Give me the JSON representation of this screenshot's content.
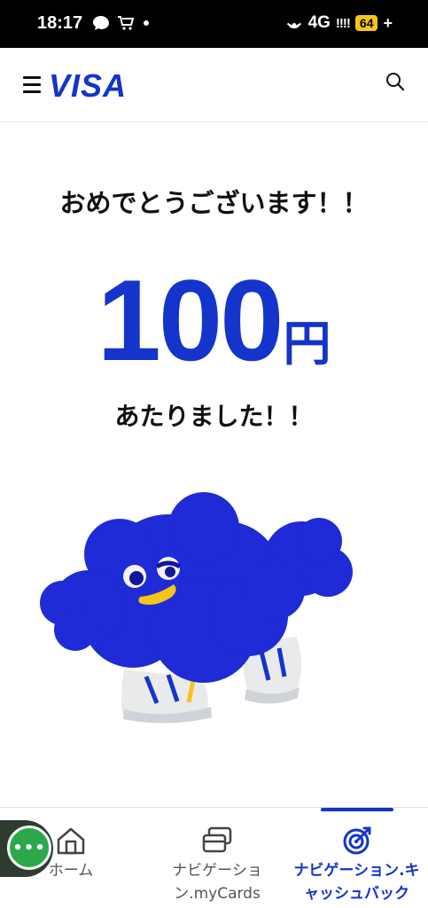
{
  "status_bar": {
    "time": "18:17",
    "network": "4G",
    "signal": "!!!!",
    "battery": "64",
    "charging": "+"
  },
  "header": {
    "logo": "VISA"
  },
  "main": {
    "congrats": "おめでとうございます！！",
    "amount": "100",
    "unit": "円",
    "won": "あたりました！！"
  },
  "bottom_nav": {
    "items": [
      {
        "label": "ホーム",
        "icon": "home-icon"
      },
      {
        "label": "ナビゲーショ\nン.myCards",
        "icon": "cards-icon"
      },
      {
        "label": "ナビゲーション.キ\nャッシュバック",
        "icon": "target-icon"
      }
    ],
    "active_index": 2
  },
  "chat": {
    "label": "•••"
  },
  "colors": {
    "brand": "#1434cb",
    "chat_green": "#2aa84a"
  }
}
